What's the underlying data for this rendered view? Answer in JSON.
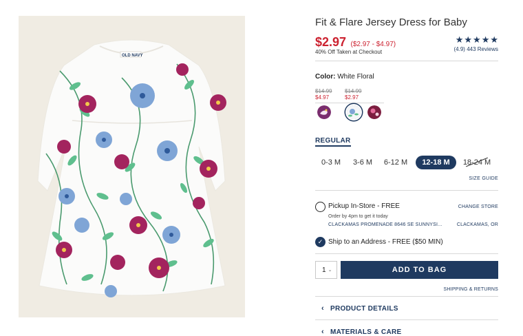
{
  "product": {
    "title": "Fit & Flare Jersey Dress for Baby",
    "price": "$2.97",
    "price_range": "($2.97 - $4.97)",
    "discount_note": "40% Off Taken at Checkout",
    "rating_stars": 5,
    "reviews": "(4.9) 443 Reviews"
  },
  "color": {
    "label": "Color:",
    "value": "White Floral",
    "swatch_prices": [
      {
        "old": "$14.99",
        "new": "$4.97"
      },
      {
        "old": "$14.99",
        "new": "$2.97"
      }
    ],
    "swatches": [
      {
        "name": "purple-unicorn",
        "selected": false
      },
      {
        "name": "white-floral",
        "selected": true
      },
      {
        "name": "burgundy-floral",
        "selected": false
      }
    ]
  },
  "size": {
    "group_label": "REGULAR",
    "options": [
      "0-3 M",
      "3-6 M",
      "6-12 M",
      "12-18 M",
      "18-24 M"
    ],
    "selected": "12-18 M",
    "unavailable": "18-24 M",
    "guide_label": "SIZE GUIDE"
  },
  "fulfillment": {
    "pickup_label": "Pickup In-Store - FREE",
    "pickup_note": "Order by 4pm to get it today",
    "change_store": "CHANGE STORE",
    "store_address": "CLACKAMAS PROMENADE 8646 SE SUNNYSI...",
    "store_city": "CLACKAMAS, OR",
    "ship_label": "Ship to an Address - FREE ($50 MIN)"
  },
  "cart": {
    "quantity": "1",
    "add_label": "ADD TO BAG",
    "shipping_link": "SHIPPING & RETURNS"
  },
  "sections": {
    "details": "PRODUCT DETAILS",
    "materials": "MATERIALS & CARE"
  },
  "colors": {
    "brand_navy": "#1f3a60",
    "sale_red": "#cc2230",
    "image_bg": "#f0ece3"
  }
}
